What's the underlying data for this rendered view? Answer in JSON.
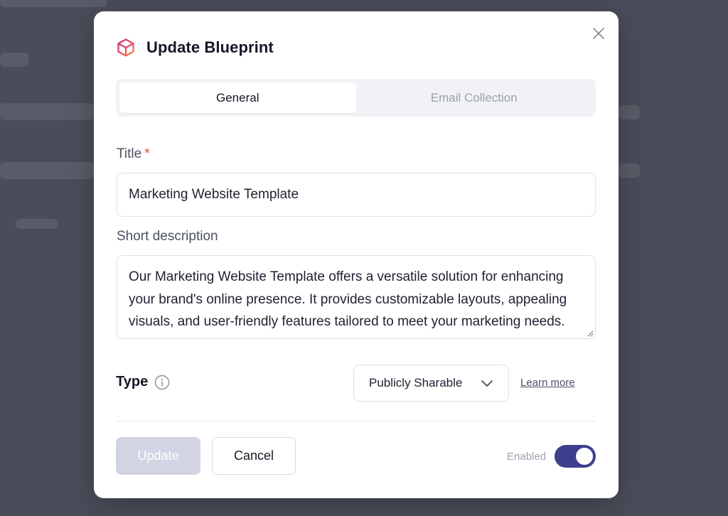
{
  "dialog": {
    "title": "Update Blueprint",
    "logo_icon": "cube-icon",
    "close_icon": "close-icon"
  },
  "tabs": [
    {
      "label": "General",
      "active": true
    },
    {
      "label": "Email Collection",
      "active": false
    }
  ],
  "form": {
    "title_label": "Title",
    "title_required_marker": "*",
    "title_value": "Marketing Website Template",
    "description_label": "Short description",
    "description_value": "Our Marketing Website Template offers a versatile solution for enhancing your brand's online presence. It provides customizable layouts, appealing visuals, and user-friendly features tailored to meet your marketing needs.",
    "type_label": "Type",
    "type_value": "Publicly Sharable",
    "learn_more": "Learn more"
  },
  "footer": {
    "update_label": "Update",
    "cancel_label": "Cancel",
    "enabled_label": "Enabled",
    "enabled": true
  },
  "colors": {
    "accent": "#3d3f8c",
    "update_disabled": "#d2d3e3",
    "required": "#e24b4b"
  }
}
